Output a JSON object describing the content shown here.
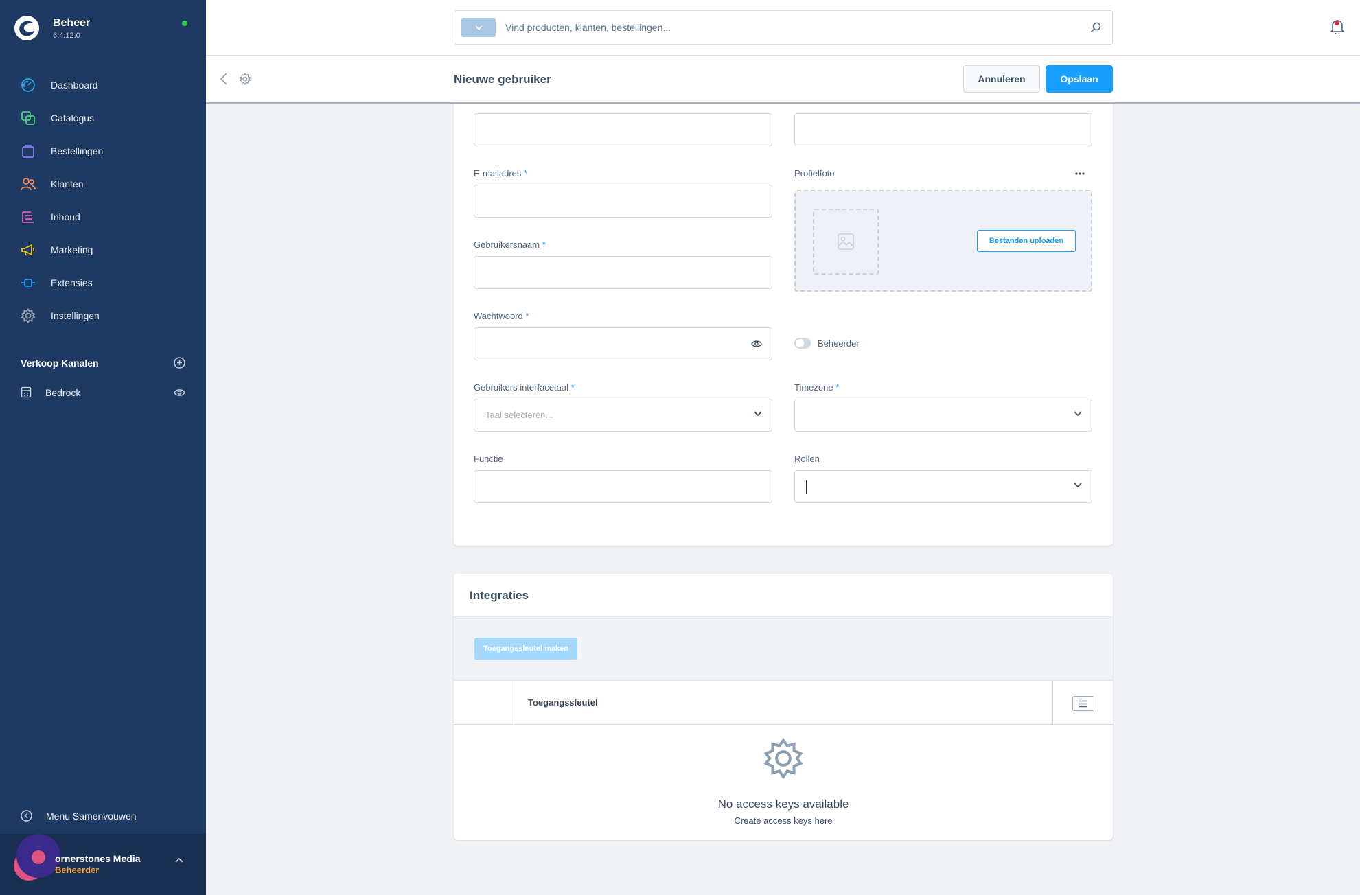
{
  "app": {
    "name": "Beheer",
    "version": "6.4.12.0"
  },
  "sidebar": {
    "items": [
      {
        "label": "Dashboard",
        "icon": "dashboard-icon",
        "color": "#29a8e0"
      },
      {
        "label": "Catalogus",
        "icon": "catalog-icon",
        "color": "#45d17e"
      },
      {
        "label": "Bestellingen",
        "icon": "orders-icon",
        "color": "#8e7cf6"
      },
      {
        "label": "Klanten",
        "icon": "customers-icon",
        "color": "#f58b56"
      },
      {
        "label": "Inhoud",
        "icon": "content-icon",
        "color": "#e060b5"
      },
      {
        "label": "Marketing",
        "icon": "marketing-icon",
        "color": "#f4c619"
      },
      {
        "label": "Extensies",
        "icon": "extensions-icon",
        "color": "#189eff"
      },
      {
        "label": "Instellingen",
        "icon": "settings-icon",
        "color": "#9aa8b5"
      }
    ],
    "channels_title": "Verkoop Kanalen",
    "channels": [
      {
        "label": "Bedrock"
      }
    ],
    "collapse_label": "Menu Samenvouwen",
    "user": {
      "name": "ornerstones Media",
      "role": "Beheerder"
    }
  },
  "search": {
    "placeholder": "Vind producten, klanten, bestellingen..."
  },
  "smartbar": {
    "title": "Nieuwe gebruiker",
    "cancel_label": "Annuleren",
    "save_label": "Opslaan"
  },
  "form": {
    "email_label": "E-mailadres",
    "profile_photo_label": "Profielfoto",
    "upload_label": "Bestanden uploaden",
    "username_label": "Gebruikersnaam",
    "password_label": "Wachtwoord",
    "admin_label": "Beheerder",
    "language_label": "Gebruikers interfacetaal",
    "language_placeholder": "Taal selecteren...",
    "timezone_label": "Timezone",
    "function_label": "Functie",
    "roles_label": "Rollen",
    "required_marker": "*"
  },
  "integrations": {
    "title": "Integraties",
    "create_key_label": "Toegangssleutel maken",
    "column_header": "Toegangssleutel",
    "empty_title": "No access keys available",
    "empty_subtitle": "Create access keys here"
  },
  "colors": {
    "sidebar_bg": "#1f3a62",
    "primary": "#189eff",
    "status_online": "#37d046",
    "role_accent": "#f8a23a"
  }
}
